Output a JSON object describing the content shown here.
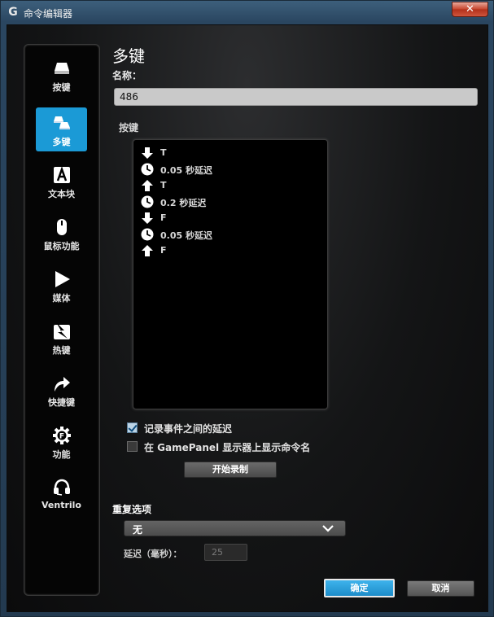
{
  "window": {
    "title": "命令编辑器",
    "logo_glyph": "G",
    "close_glyph": "✕"
  },
  "sidebar": {
    "items": [
      {
        "label": "按键",
        "icon": "keycap-icon",
        "active": false
      },
      {
        "label": "多键",
        "icon": "multi-key-icon",
        "active": true
      },
      {
        "label": "文本块",
        "icon": "text-block-icon",
        "active": false
      },
      {
        "label": "鼠标功能",
        "icon": "mouse-icon",
        "active": false
      },
      {
        "label": "媒体",
        "icon": "play-icon",
        "active": false
      },
      {
        "label": "热键",
        "icon": "hotkey-icon",
        "active": false
      },
      {
        "label": "快捷键",
        "icon": "shortcut-arrow-icon",
        "active": false
      },
      {
        "label": "功能",
        "icon": "function-gear-icon",
        "active": false
      },
      {
        "label": "Ventrilo",
        "icon": "headset-icon",
        "active": false
      }
    ]
  },
  "main": {
    "title": "多键",
    "name_label": "名称：",
    "name_value": "486",
    "keys_label": "按键",
    "events": [
      {
        "type": "down",
        "icon": "arrow-down-icon",
        "text": "T"
      },
      {
        "type": "delay",
        "icon": "clock-icon",
        "text": "0.05 秒延迟"
      },
      {
        "type": "up",
        "icon": "arrow-up-icon",
        "text": "T"
      },
      {
        "type": "delay",
        "icon": "clock-icon",
        "text": "0.2 秒延迟"
      },
      {
        "type": "down",
        "icon": "arrow-down-icon",
        "text": "F"
      },
      {
        "type": "delay",
        "icon": "clock-icon",
        "text": "0.05 秒延迟"
      },
      {
        "type": "up",
        "icon": "arrow-up-icon",
        "text": "F"
      }
    ],
    "record_delays_label": "记录事件之间的延迟",
    "record_delays_checked": true,
    "show_name_label": "在 GamePanel 显示器上显示命令名",
    "show_name_checked": false,
    "record_button": "开始录制",
    "repeat_label": "重复选项",
    "repeat_value": "无",
    "delay_label": "延迟（毫秒）：",
    "delay_value": "25"
  },
  "footer": {
    "ok": "确定",
    "cancel": "取消"
  },
  "colors": {
    "accent": "#1b9ad6",
    "title_bar": "#3d5f7c",
    "panel": "#000000"
  }
}
